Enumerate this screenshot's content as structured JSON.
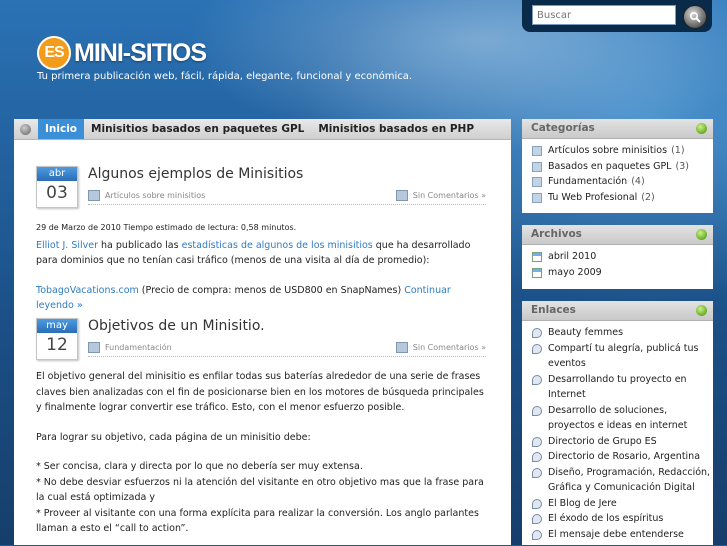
{
  "header": {
    "search_placeholder": "Buscar",
    "logo_badge": "ES",
    "logo_text": "MINI-SITIOS",
    "tagline": "Tu primera publicación web, fácil, rápida, elegante, funcional y económica."
  },
  "nav": {
    "items": [
      "Inicio",
      "Minisitios basados en paquetes GPL",
      "Minisitios basados en PHP"
    ]
  },
  "posts": [
    {
      "month": "abr",
      "day": "03",
      "title": "Algunos ejemplos de Minisitios",
      "category": "Artículos sobre minisitios",
      "comments": "Sin Comentarios »",
      "date_line": "29 de Marzo de 2010 Tiempo estimado de lectura: 0,58 minutos.",
      "author_link": "Elliot J. Silver",
      "text_a": " ha publicado las ",
      "stats_link": "estadísticas de algunos de los minisitios",
      "text_b": " que ha desarrollado para dominios que no tenían casi tráfico (menos de una visita al día de promedio):",
      "site_link": "TobagoVacations.com",
      "price_text": " (Precio de compra: menos de USD800 en SnapNames) ",
      "more_link": "Continuar leyendo »"
    },
    {
      "month": "may",
      "day": "12",
      "title": "Objetivos de un Minisitio.",
      "category": "Fundamentación",
      "comments": "Sin Comentarios »",
      "p1": "El objetivo general del minisitio es enfilar todas sus baterías alrededor de una serie de frases claves bien analizadas con el fin de posicionarse bien en los motores de búsqueda principales y finalmente lograr convertir ese tráfico. Esto, con el menor esfuerzo posible.",
      "p2": "Para lograr su objetivo, cada página de un minisitio debe:",
      "b1": "* Ser concisa, clara y directa por lo que no debería ser muy extensa.",
      "b2": "* No debe desviar esfuerzos ni la atención del visitante en otro objetivo mas que la frase para la cual está optimizada y",
      "b3": "* Proveer al visitante con una forma explícita para realizar la conversión. Los anglo parlantes llaman a esto el “call to action”."
    }
  ],
  "sidebar": {
    "categorias": {
      "title": "Categorías",
      "items": [
        {
          "label": "Artículos sobre minisitios",
          "count": "(1)"
        },
        {
          "label": "Basados en paquetes GPL",
          "count": "(3)"
        },
        {
          "label": "Fundamentación",
          "count": "(4)"
        },
        {
          "label": "Tu Web Profesional",
          "count": "(2)"
        }
      ]
    },
    "archivos": {
      "title": "Archivos",
      "items": [
        "abril 2010",
        "mayo 2009"
      ]
    },
    "enlaces": {
      "title": "Enlaces",
      "items": [
        "Beauty femmes",
        "Compartí tu alegría, publicá tus eventos",
        "Desarrollando tu proyecto en Internet",
        "Desarrollo de soluciones, proyectos e ideas en internet",
        "Directorio de Grupo ES",
        "Directorio de Rosario, Argentina",
        "Diseño, Programación, Redacción, Gráfica y Comunicación Digital",
        "El Blog de Jere",
        "El éxodo de los espíritus",
        "El mensaje debe entenderse"
      ]
    }
  },
  "colors": {
    "accent": "#3a8fd6",
    "link": "#2f7cc1",
    "logo_badge": "#f39b1b",
    "background": "#1f5a93"
  }
}
